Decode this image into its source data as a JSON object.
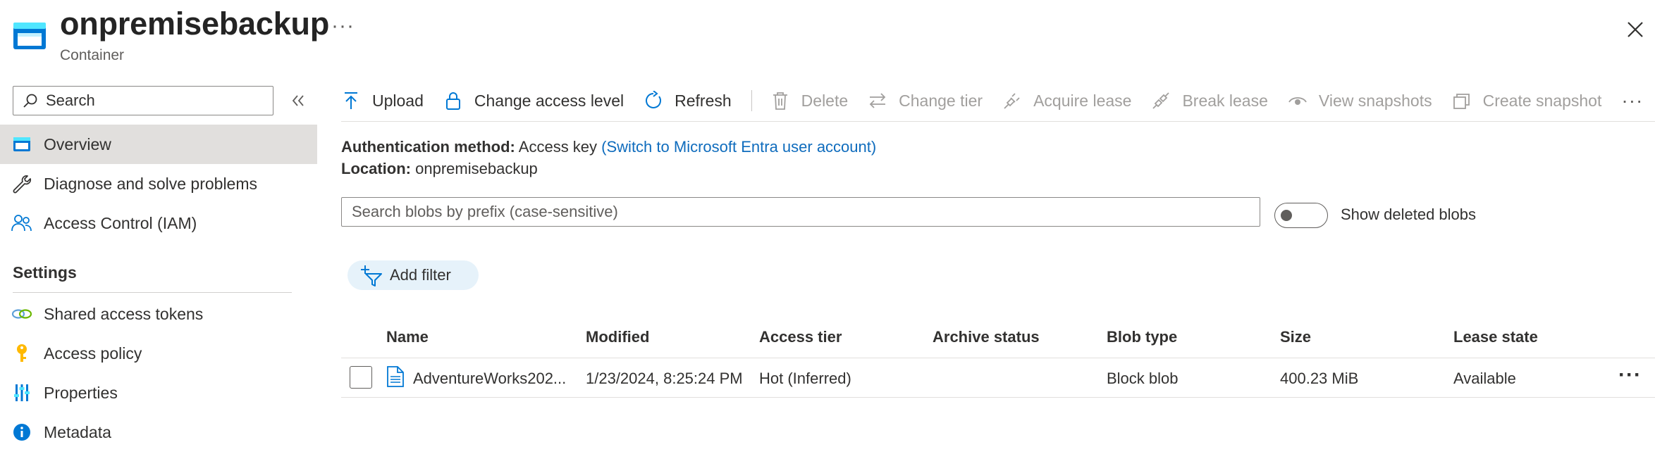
{
  "header": {
    "title": "onpremisebackup",
    "subtitle": "Container",
    "more": "···",
    "icon": "container-icon"
  },
  "sidebar": {
    "search_placeholder": "Search",
    "collapse_icon": "double-chevron-left-icon",
    "items": [
      {
        "label": "Overview",
        "icon": "container-icon",
        "active": true
      },
      {
        "label": "Diagnose and solve problems",
        "icon": "wrench-icon"
      },
      {
        "label": "Access Control (IAM)",
        "icon": "people-icon"
      }
    ],
    "settings_header": "Settings",
    "settings_items": [
      {
        "label": "Shared access tokens",
        "icon": "link-chain-icon"
      },
      {
        "label": "Access policy",
        "icon": "key-icon"
      },
      {
        "label": "Properties",
        "icon": "sliders-icon"
      },
      {
        "label": "Metadata",
        "icon": "info-icon"
      }
    ]
  },
  "toolbar": {
    "upload": "Upload",
    "change_access_level": "Change access level",
    "refresh": "Refresh",
    "delete": "Delete",
    "change_tier": "Change tier",
    "acquire_lease": "Acquire lease",
    "break_lease": "Break lease",
    "view_snapshots": "View snapshots",
    "create_snapshot": "Create snapshot",
    "more": "···"
  },
  "info": {
    "auth_label": "Authentication method:",
    "auth_value": "Access key",
    "auth_link": "(Switch to Microsoft Entra user account)",
    "location_label": "Location:",
    "location_value": "onpremisebackup"
  },
  "blob_search": {
    "placeholder": "Search blobs by prefix (case-sensitive)"
  },
  "show_deleted": {
    "label": "Show deleted blobs",
    "on": false
  },
  "add_filter": "Add filter",
  "table": {
    "columns": [
      "Name",
      "Modified",
      "Access tier",
      "Archive status",
      "Blob type",
      "Size",
      "Lease state"
    ],
    "rows": [
      {
        "name": "AdventureWorks202...",
        "modified": "1/23/2024, 8:25:24 PM",
        "access_tier": "Hot (Inferred)",
        "archive_status": "",
        "blob_type": "Block blob",
        "size": "400.23 MiB",
        "lease_state": "Available",
        "more": "···"
      }
    ]
  },
  "colors": {
    "accent": "#0f6cbd",
    "active_nav": "#e1dfdd",
    "filter_pill": "#e6f2fa",
    "disabled_text": "#a19f9d"
  }
}
